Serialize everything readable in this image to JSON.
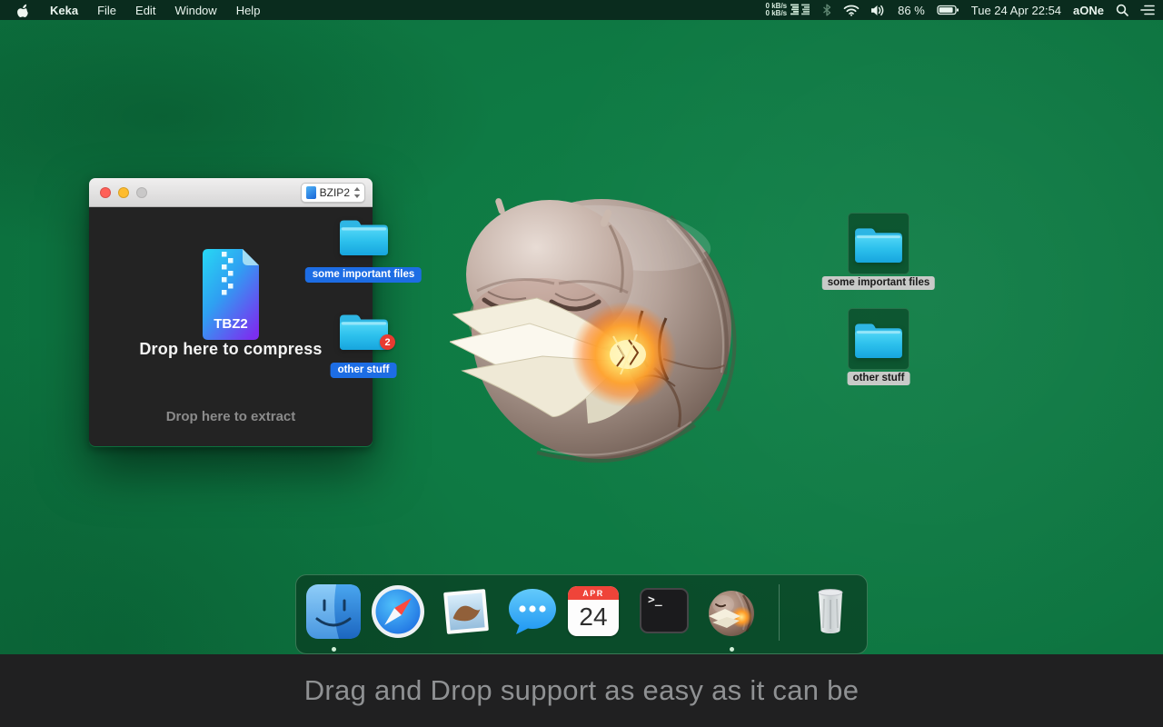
{
  "menu_bar": {
    "app_name": "Keka",
    "menus": [
      "File",
      "Edit",
      "Window",
      "Help"
    ],
    "status": {
      "net_up": "0 kB/s",
      "net_down": "0 kB/s",
      "battery": "86 %",
      "clock": "Tue 24 Apr 22:54",
      "account": "aONe"
    }
  },
  "window": {
    "format_select": "BZIP2",
    "file_type": "TBZ2",
    "drop_compress": "Drop here to compress",
    "drop_extract": "Drop here to extract"
  },
  "drag_items": {
    "first_label": "some important files",
    "second_label": "other stuff",
    "second_badge": "2"
  },
  "desktop_items": {
    "first_label": "some important files",
    "second_label": "other stuff"
  },
  "dock": {
    "items": [
      "finder",
      "safari",
      "mail",
      "messages",
      "calendar",
      "terminal",
      "keka",
      "trash"
    ],
    "calendar_month": "APR",
    "calendar_day": "24",
    "terminal_prompt": ">_"
  },
  "caption": "Drag and Drop support as easy as it can be",
  "icons": {
    "menu_bar": [
      "apple",
      "network-graph",
      "bluetooth",
      "wifi",
      "volume",
      "battery",
      "spotlight-search",
      "notification-list"
    ],
    "window": [
      "close",
      "minimize",
      "zoom",
      "file-format",
      "chevron-updown",
      "tbz2-file"
    ],
    "desktop": [
      "folder"
    ],
    "dock": [
      "finder",
      "safari",
      "mail",
      "messages",
      "calendar",
      "terminal",
      "keka",
      "trash"
    ]
  },
  "colors": {
    "desktop_green": "#0d7440",
    "menubar_green": "#0a2c1e",
    "window_body": "#232323",
    "label_blue": "#1d6de4",
    "badge_red": "#e83b31",
    "folder_cyan": "#2cc0ec",
    "caption_bg": "#202021",
    "caption_text": "#8f9193"
  }
}
